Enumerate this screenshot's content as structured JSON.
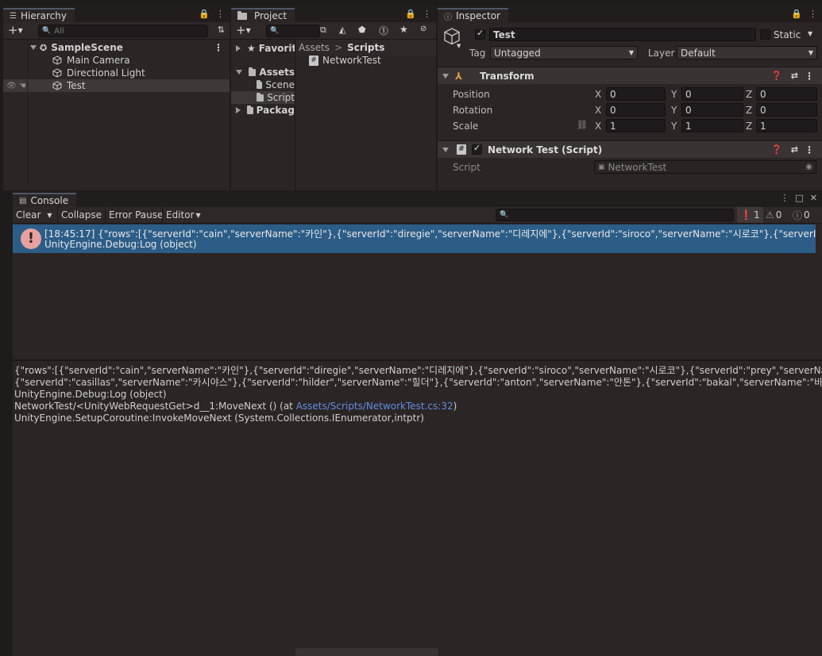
{
  "hierarchy": {
    "tab": "Hierarchy",
    "search_placeholder": "All",
    "scene": "SampleScene",
    "items": [
      "Main Camera",
      "Directional Light",
      "Test"
    ]
  },
  "project": {
    "tab": "Project",
    "favorites": "Favorite",
    "assets": "Assets",
    "folders": [
      "Scene",
      "Script"
    ],
    "packages": "Packag",
    "breadcrumb_root": "Assets",
    "breadcrumb_sep": ">",
    "breadcrumb_current": "Scripts",
    "file": "NetworkTest"
  },
  "inspector": {
    "tab": "Inspector",
    "object_name": "Test",
    "static_label": "Static",
    "tag_label": "Tag",
    "tag_value": "Untagged",
    "layer_label": "Layer",
    "layer_value": "Default",
    "transform": {
      "title": "Transform",
      "rows": [
        {
          "label": "Position",
          "x": "0",
          "y": "0",
          "z": "0"
        },
        {
          "label": "Rotation",
          "x": "0",
          "y": "0",
          "z": "0"
        },
        {
          "label": "Scale",
          "x": "1",
          "y": "1",
          "z": "1"
        }
      ],
      "axis_x": "X",
      "axis_y": "Y",
      "axis_z": "Z"
    },
    "script_component": {
      "title": "Network Test (Script)",
      "script_label": "Script",
      "script_value": "NetworkTest"
    }
  },
  "console": {
    "tab": "Console",
    "clear": "Clear",
    "collapse": "Collapse",
    "error_pause": "Error Pause",
    "editor": "Editor",
    "count_errors": "1",
    "count_warnings": "0",
    "count_info": "0",
    "entry_line1": "[18:45:17] {\"rows\":[{\"serverId\":\"cain\",\"serverName\":\"카인\"},{\"serverId\":\"diregie\",\"serverName\":\"디레지에\"},{\"serverId\":\"siroco\",\"serverName\":\"시로코\"},{\"serverId\":\"prey\",\"serverI",
    "entry_line2": "UnityEngine.Debug:Log (object)",
    "detail_line1": "{\"rows\":[{\"serverId\":\"cain\",\"serverName\":\"카인\"},{\"serverId\":\"diregie\",\"serverName\":\"디레지에\"},{\"serverId\":\"siroco\",\"serverName\":\"시로코\"},{\"serverId\":\"prey\",\"serverName\":\"프레이\"},",
    "detail_line2": "{\"serverId\":\"casillas\",\"serverName\":\"카시야스\"},{\"serverId\":\"hilder\",\"serverName\":\"힐더\"},{\"serverId\":\"anton\",\"serverName\":\"안톤\"},{\"serverId\":\"bakal\",\"serverName\":\"바칼\"}]}",
    "detail_line3": "UnityEngine.Debug:Log (object)",
    "detail_line4_prefix": "NetworkTest/<UnityWebRequestGet>d__1:MoveNext () (at ",
    "detail_line4_link": "Assets/Scripts/NetworkTest.cs:32",
    "detail_line4_suffix": ")",
    "detail_line5": "UnityEngine.SetupCoroutine:InvokeMoveNext (System.Collections.IEnumerator,intptr)"
  },
  "colors": {
    "selection": "#2c5d87",
    "error_icon": "#e8a0a0",
    "link": "#5f8fdf"
  }
}
